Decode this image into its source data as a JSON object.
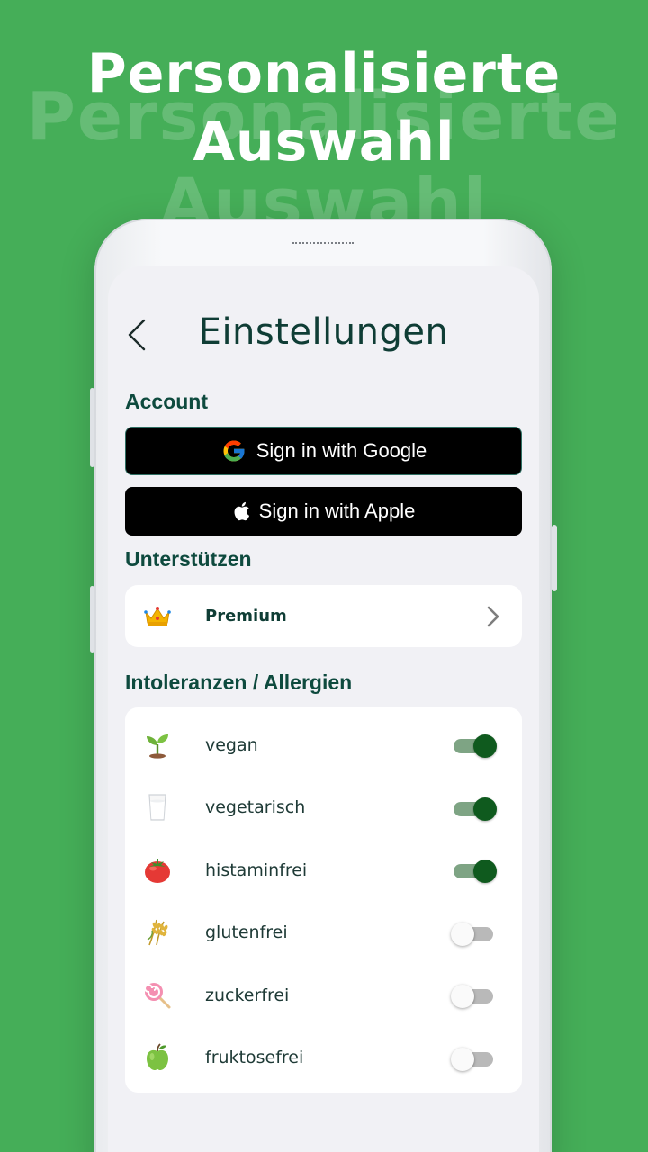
{
  "headline": {
    "line1": "Personalisierte",
    "line2": "Auswahl"
  },
  "screen": {
    "title": "Einstellungen",
    "account": {
      "label": "Account",
      "google_button": "Sign in with Google",
      "apple_button": "Sign in with Apple"
    },
    "support": {
      "label": "Unterstützen",
      "premium": {
        "icon": "crown-icon",
        "label": "Premium"
      }
    },
    "intolerances": {
      "label": "Intoleranzen / Allergien",
      "items": [
        {
          "icon": "seedling-icon",
          "label": "vegan",
          "enabled": true
        },
        {
          "icon": "milk-glass-icon",
          "label": "vegetarisch",
          "enabled": true
        },
        {
          "icon": "tomato-icon",
          "label": "histaminfrei",
          "enabled": true
        },
        {
          "icon": "wheat-icon",
          "label": "glutenfrei",
          "enabled": false
        },
        {
          "icon": "lollipop-icon",
          "label": "zuckerfrei",
          "enabled": false
        },
        {
          "icon": "green-apple-icon",
          "label": "fruktosefrei",
          "enabled": false
        }
      ]
    }
  },
  "colors": {
    "background": "#45ae58",
    "title_text": "#0f3d35",
    "toggle_on_knob": "#0f5a1e",
    "toggle_on_track": "#7ea484",
    "toggle_off_track": "#b9b9b9"
  }
}
